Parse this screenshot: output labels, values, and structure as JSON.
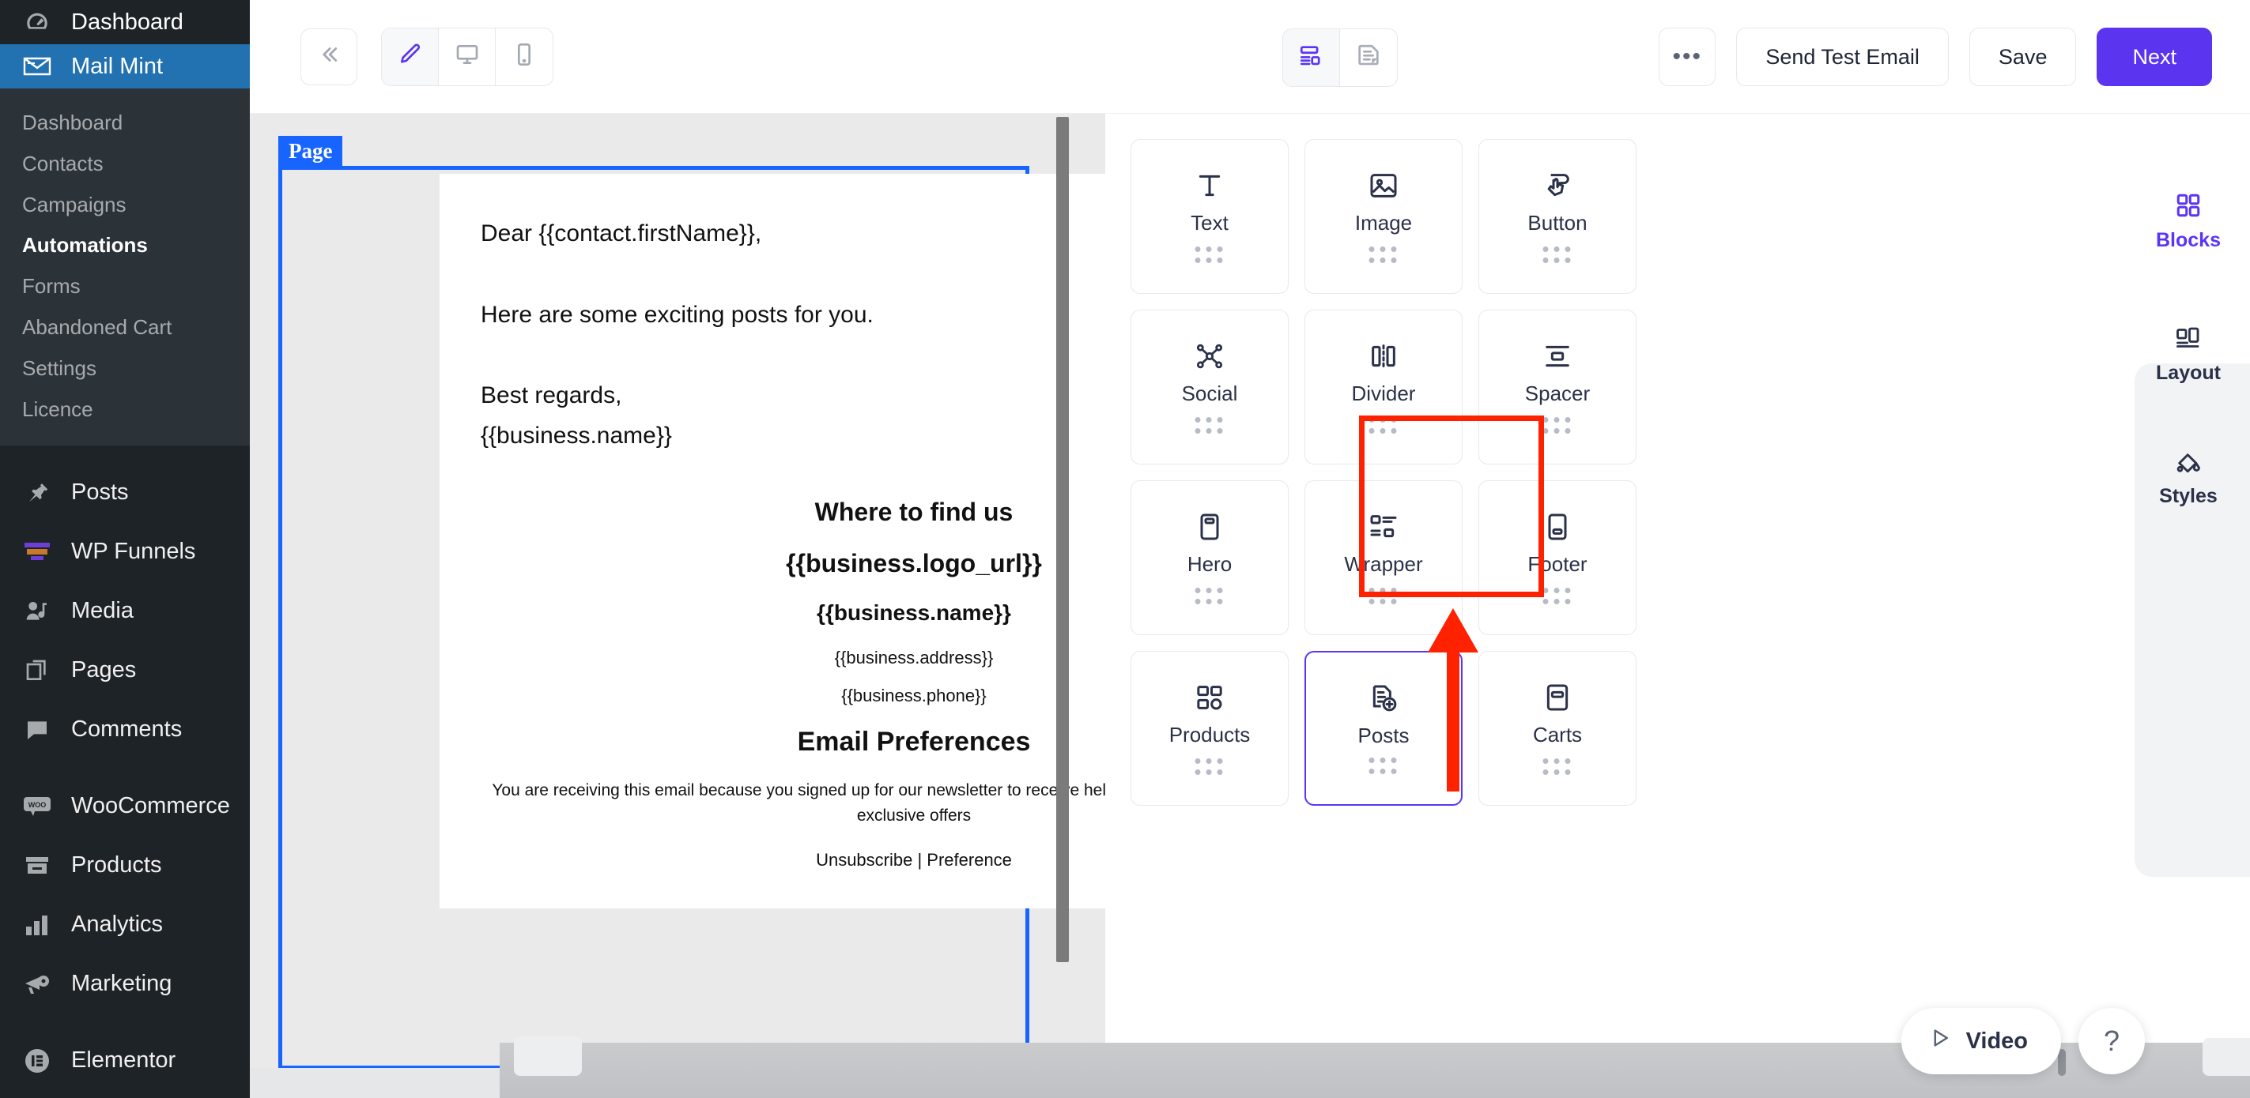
{
  "sidebar": {
    "top_items": [
      {
        "label": "Dashboard",
        "icon": "dashboard-icon",
        "active": false
      },
      {
        "label": "Mail Mint",
        "icon": "envelope-icon",
        "active": true
      }
    ],
    "submenu": [
      {
        "label": "Dashboard",
        "current": false
      },
      {
        "label": "Contacts",
        "current": false
      },
      {
        "label": "Campaigns",
        "current": false
      },
      {
        "label": "Automations",
        "current": true
      },
      {
        "label": "Forms",
        "current": false
      },
      {
        "label": "Abandoned Cart",
        "current": false
      },
      {
        "label": "Settings",
        "current": false
      },
      {
        "label": "Licence",
        "current": false
      }
    ],
    "nav_items": [
      {
        "label": "Posts",
        "icon": "pin-icon"
      },
      {
        "label": "WP Funnels",
        "icon": "funnel-icon"
      },
      {
        "label": "Media",
        "icon": "media-icon"
      },
      {
        "label": "Pages",
        "icon": "pages-icon"
      },
      {
        "label": "Comments",
        "icon": "comment-icon"
      },
      {
        "label": "WooCommerce",
        "icon": "woo-icon"
      },
      {
        "label": "Products",
        "icon": "products-icon"
      },
      {
        "label": "Analytics",
        "icon": "analytics-bars-icon"
      },
      {
        "label": "Marketing",
        "icon": "megaphone-icon"
      },
      {
        "label": "Elementor",
        "icon": "elementor-icon"
      }
    ]
  },
  "toolbar": {
    "collapse_icon": "chevrons-left-icon",
    "view_modes": [
      {
        "icon": "pencil-icon",
        "name": "edit-mode",
        "active": true
      },
      {
        "icon": "desktop-icon",
        "name": "desktop-preview",
        "active": false
      },
      {
        "icon": "mobile-icon",
        "name": "mobile-preview",
        "active": false
      }
    ],
    "center_modes": [
      {
        "icon": "layout-blocks-icon",
        "name": "visual-builder",
        "active": true
      },
      {
        "icon": "document-text-icon",
        "name": "plain-text",
        "active": false
      }
    ],
    "more_label": "•••",
    "send_test_label": "Send Test Email",
    "save_label": "Save",
    "next_label": "Next"
  },
  "canvas": {
    "selection_badge": "Page",
    "selection_color": "#1864ff",
    "email": {
      "greeting": "Dear {{contact.firstName}},",
      "intro": "Here are some exciting posts for you.",
      "signoff": "Best regards,",
      "business_name_tag": "{{business.name}}",
      "footer": {
        "heading": "Where to find us",
        "logo_tag": "{{business.logo_url}}",
        "name_tag": "{{business.name}}",
        "address_tag": "{{business.address}}",
        "phone_tag": "{{business.phone}}",
        "preferences_heading": "Email Preferences",
        "disclaimer": "You are receiving this email because you signed up for our newsletter to receive helpful tips, product launches, and exclusive offers",
        "links": "Unsubscribe | Preference"
      }
    }
  },
  "blocks_panel": {
    "tiles": [
      {
        "label": "Text",
        "icon": "text-t-icon",
        "selected": false
      },
      {
        "label": "Image",
        "icon": "image-icon",
        "selected": false
      },
      {
        "label": "Button",
        "icon": "button-click-icon",
        "selected": false
      },
      {
        "label": "Social",
        "icon": "social-share-icon",
        "selected": false
      },
      {
        "label": "Divider",
        "icon": "divider-icon",
        "selected": false
      },
      {
        "label": "Spacer",
        "icon": "spacer-icon",
        "selected": false
      },
      {
        "label": "Hero",
        "icon": "hero-icon",
        "selected": false
      },
      {
        "label": "Wrapper",
        "icon": "wrapper-icon",
        "selected": false
      },
      {
        "label": "Footer",
        "icon": "footer-icon",
        "selected": false
      },
      {
        "label": "Products",
        "icon": "products-grid-icon",
        "selected": false
      },
      {
        "label": "Posts",
        "icon": "post-add-icon",
        "selected": true
      },
      {
        "label": "Carts",
        "icon": "cart-block-icon",
        "selected": false
      }
    ],
    "highlight_color": "#ff2200",
    "selected_border_color": "#5b34f5"
  },
  "rail": {
    "tabs": [
      {
        "label": "Blocks",
        "icon": "blocks-grid-icon",
        "active": true
      },
      {
        "label": "Layout",
        "icon": "layout-panel-icon",
        "active": false
      },
      {
        "label": "Styles",
        "icon": "paint-bucket-icon",
        "active": false
      }
    ],
    "accent_color": "#5b34f5"
  },
  "floating": {
    "video_label": "Video",
    "video_icon": "play-triangle-icon",
    "help_label": "?"
  }
}
